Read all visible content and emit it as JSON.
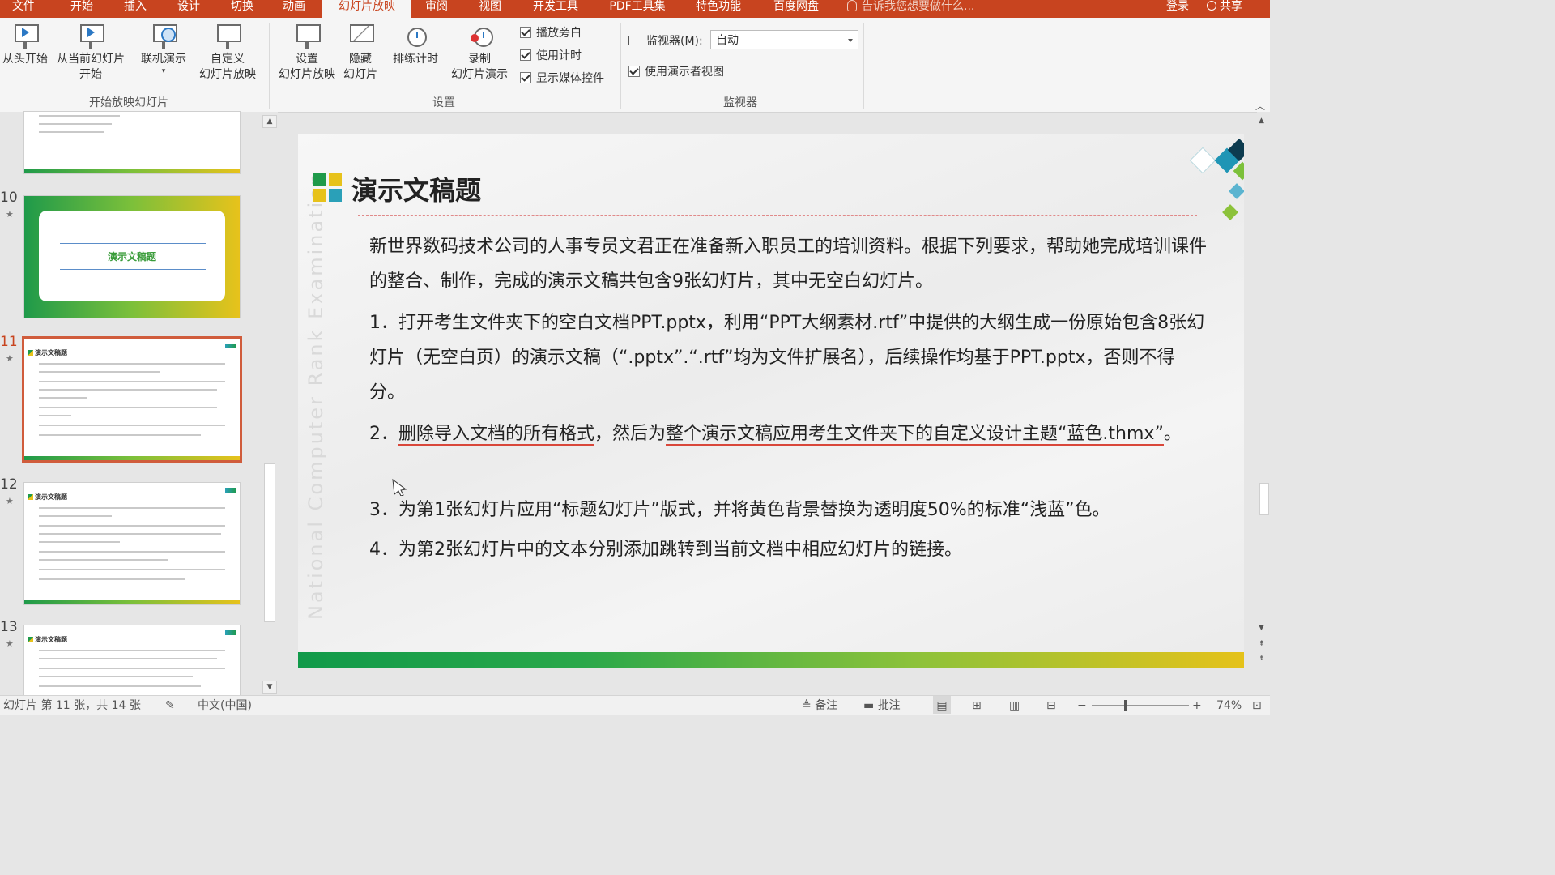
{
  "tabs": [
    {
      "label": "文件",
      "active": false
    },
    {
      "label": "开始",
      "active": false
    },
    {
      "label": "插入",
      "active": false
    },
    {
      "label": "设计",
      "active": false
    },
    {
      "label": "切换",
      "active": false
    },
    {
      "label": "动画",
      "active": false
    },
    {
      "label": "幻灯片放映",
      "active": true
    },
    {
      "label": "审阅",
      "active": false
    },
    {
      "label": "视图",
      "active": false
    },
    {
      "label": "开发工具",
      "active": false
    },
    {
      "label": "PDF工具集",
      "active": false
    },
    {
      "label": "特色功能",
      "active": false
    },
    {
      "label": "百度网盘",
      "active": false
    }
  ],
  "tellme": "告诉我您想要做什么...",
  "login": "登录",
  "share": "共享",
  "ribbon": {
    "group_start": {
      "label": "开始放映幻灯片",
      "from_beginning": "从头开始",
      "from_current_1": "从当前幻灯片",
      "from_current_2": "开始",
      "online": "联机演示",
      "custom_1": "自定义",
      "custom_2": "幻灯片放映"
    },
    "group_setup": {
      "label": "设置",
      "setup_1": "设置",
      "setup_2": "幻灯片放映",
      "hide_1": "隐藏",
      "hide_2": "幻灯片",
      "rehearse": "排练计时",
      "record_1": "录制",
      "record_2": "幻灯片演示",
      "chk_narration": "播放旁白",
      "chk_timing": "使用计时",
      "chk_media": "显示媒体控件"
    },
    "group_monitor": {
      "label": "监视器",
      "monitor_label": "监视器(M):",
      "monitor_value": "自动",
      "presenter_view": "使用演示者视图"
    }
  },
  "thumbs": {
    "t10_num": "10",
    "t10_title": "演示文稿题",
    "t11_num": "11",
    "t12_num": "12",
    "t13_num": "13",
    "mini_title": "演示文稿题",
    "star": "★"
  },
  "slide": {
    "title": "演示文稿题",
    "watermark": "National Computer Rank Examination",
    "intro": "新世界数码技术公司的人事专员文君正在准备新入职员工的培训资料。根据下列要求，帮助她完成培训课件的整合、制作，完成的演示文稿共包含9张幻灯片，其中无空白幻灯片。",
    "item1": "1．打开考生文件夹下的空白文档PPT.pptx，利用“PPT大纲素材.rtf”中提供的大纲生成一份原始包含8张幻灯片（无空白页）的演示文稿（“.pptx”.“.rtf”均为文件扩展名），后续操作均基于PPT.pptx，否则不得分。",
    "item2_a": "2．",
    "item2_b": "删除导入文档的所有格式",
    "item2_c": "，然后为",
    "item2_d": "整个演示文稿应用考生文件夹下的自定义设计主题“蓝色.thmx”",
    "item2_e": "。",
    "item3": "3．为第1张幻灯片应用“标题幻灯片”版式，并将黄色背景替换为透明度50%的标准“浅蓝”色。",
    "item4": "4．为第2张幻灯片中的文本分别添加跳转到当前文档中相应幻灯片的链接。"
  },
  "status": {
    "slide_info": "幻灯片 第 11 张，共 14 张",
    "language": "中文(中国)",
    "notes": "备注",
    "comments": "批注",
    "zoom": "74%"
  },
  "colors": {
    "accent": "#c8441f",
    "green": "#1f9a4a",
    "yellow": "#e7c21b"
  }
}
